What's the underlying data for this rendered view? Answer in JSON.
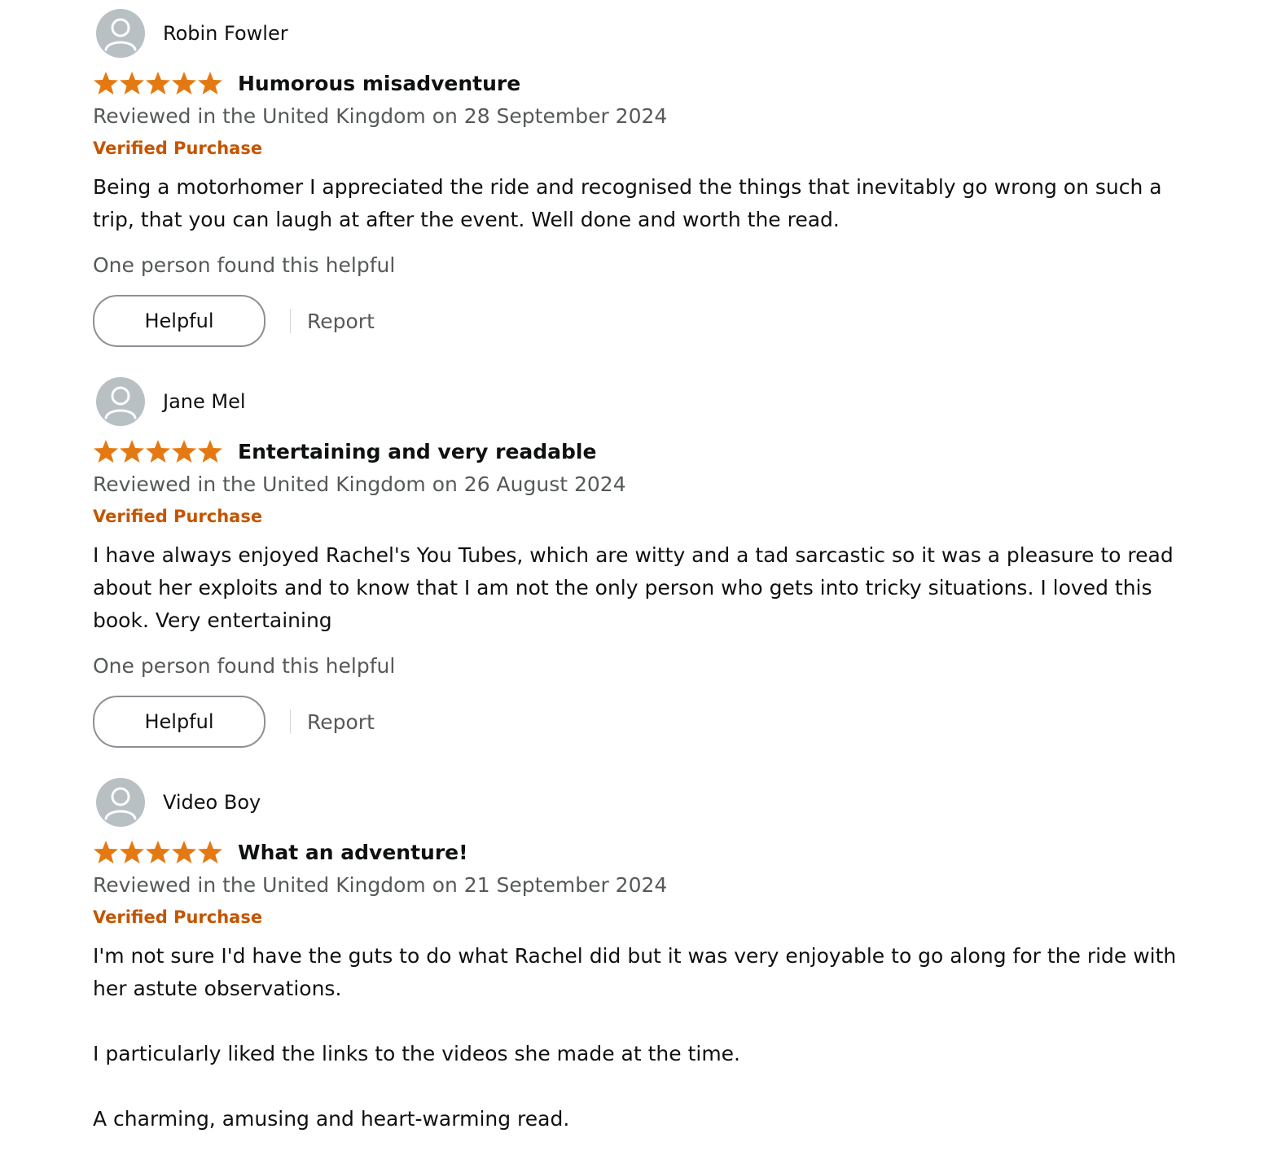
{
  "colors": {
    "star": "#e47911",
    "verified": "#c45500",
    "muted": "#565959",
    "text": "#0f1111"
  },
  "icons": {
    "avatar": "default-profile-icon",
    "star": "filled-star-icon"
  },
  "reviews": [
    {
      "author": "Robin Fowler",
      "rating": 5,
      "title": "Humorous misadventure",
      "date": "Reviewed in the United Kingdom on 28 September 2024",
      "verified": "Verified Purchase",
      "body": "Being a motorhomer I appreciated the ride and recognised the things that inevitably go wrong on such a trip, that you can laugh at after the event. Well done and worth the read.",
      "helpful_count": "One person found this helpful",
      "helpful_label": "Helpful",
      "report_label": "Report"
    },
    {
      "author": "Jane Mel",
      "rating": 5,
      "title": "Entertaining and very readable",
      "date": "Reviewed in the United Kingdom on 26 August 2024",
      "verified": "Verified Purchase",
      "body": "I have always enjoyed Rachel's You Tubes, which are witty and a tad sarcastic so it was a pleasure to read about her exploits and to know that I am not the only person who gets into tricky situations. I loved this book. Very entertaining",
      "helpful_count": "One person found this helpful",
      "helpful_label": "Helpful",
      "report_label": "Report"
    },
    {
      "author": "Video Boy",
      "rating": 5,
      "title": "What an adventure!",
      "date": "Reviewed in the United Kingdom on 21 September 2024",
      "verified": "Verified Purchase",
      "body": "I'm not sure I'd have the guts to do what Rachel did but it was very enjoyable to go along for the ride with her astute observations.\n\nI particularly liked the links to the videos she made at the time.\n\nA charming, amusing and heart-warming read."
    }
  ]
}
